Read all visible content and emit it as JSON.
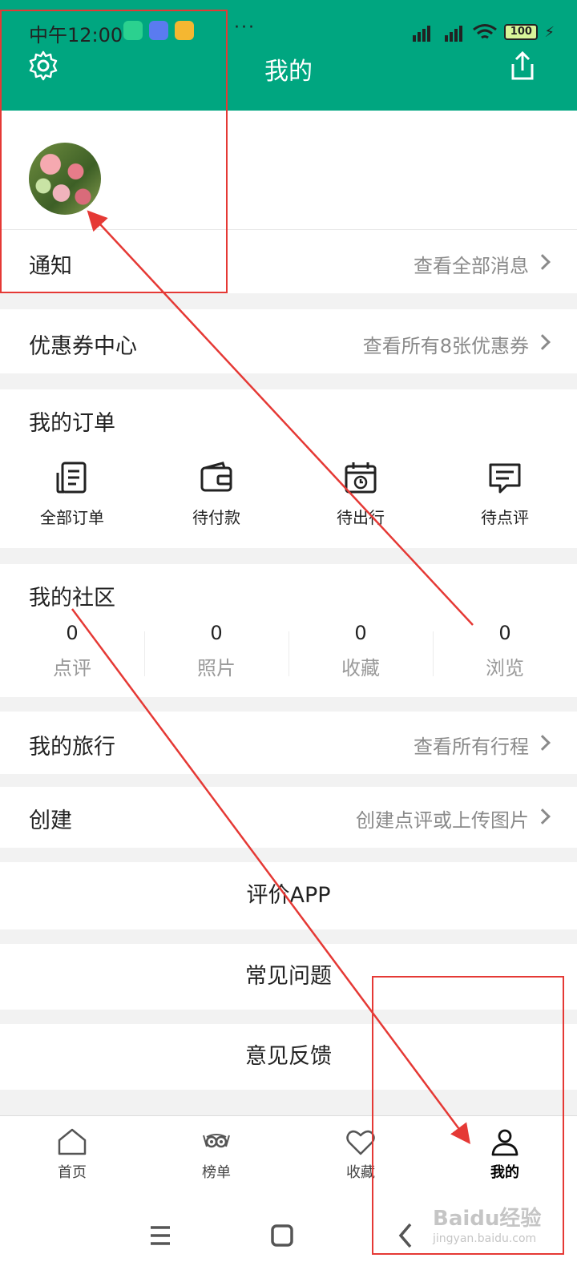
{
  "status_bar": {
    "time": "中午12:00",
    "more": "···",
    "battery": "100"
  },
  "header": {
    "title": "我的",
    "color": "#00a680"
  },
  "notice": {
    "label": "通知",
    "link": "查看全部消息"
  },
  "coupon": {
    "label": "优惠券中心",
    "link": "查看所有8张优惠券"
  },
  "orders": {
    "title": "我的订单",
    "items": [
      {
        "label": "全部订单",
        "icon": "order-list-icon"
      },
      {
        "label": "待付款",
        "icon": "wallet-icon"
      },
      {
        "label": "待出行",
        "icon": "calendar-icon"
      },
      {
        "label": "待点评",
        "icon": "comment-icon"
      }
    ]
  },
  "community": {
    "title": "我的社区",
    "stats": [
      {
        "value": "0",
        "label": "点评"
      },
      {
        "value": "0",
        "label": "照片"
      },
      {
        "value": "0",
        "label": "收藏"
      },
      {
        "value": "0",
        "label": "浏览"
      }
    ]
  },
  "travel": {
    "label": "我的旅行",
    "link": "查看所有行程"
  },
  "create": {
    "label": "创建",
    "link": "创建点评或上传图片"
  },
  "actions": {
    "rate_app": "评价APP",
    "faq": "常见问题",
    "feedback": "意见反馈"
  },
  "tabbar": {
    "items": [
      {
        "label": "首页",
        "icon": "home-icon"
      },
      {
        "label": "榜单",
        "icon": "owl-icon"
      },
      {
        "label": "收藏",
        "icon": "heart-icon"
      },
      {
        "label": "我的",
        "icon": "person-icon",
        "active": true
      }
    ]
  },
  "watermark": {
    "main": "Baidu经验",
    "sub": "jingyan.baidu.com"
  },
  "annotation_color": "#e53935"
}
